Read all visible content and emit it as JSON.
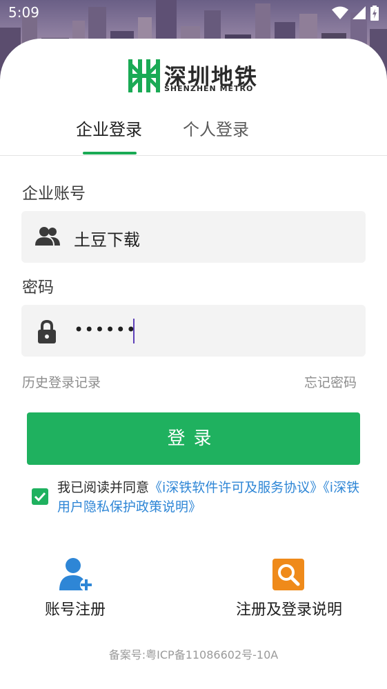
{
  "status_bar": {
    "time": "5:09",
    "icons": [
      "wifi-icon",
      "cellular-signal-icon",
      "battery-charging-icon"
    ]
  },
  "logo": {
    "name_cn": "深圳地铁",
    "name_en": "SHENZHEN METRO"
  },
  "tabs": [
    {
      "label": "企业登录",
      "active": true
    },
    {
      "label": "个人登录",
      "active": false
    }
  ],
  "form": {
    "account_label": "企业账号",
    "account_value": "土豆下载",
    "account_icon": "group-icon",
    "password_label": "密码",
    "password_value": "••••••",
    "password_icon": "lock-icon"
  },
  "links": {
    "history": "历史登录记录",
    "forgot": "忘记密码"
  },
  "login_button": "登录",
  "agreement": {
    "checked": true,
    "prefix": "我已阅读并同意",
    "link1": "《i深铁软件许可及服务协议》",
    "link2": "《i深铁用户隐私保护政策说明》"
  },
  "bottom_actions": [
    {
      "label": "账号注册",
      "icon": "user-add-icon",
      "color": "#2e86d6"
    },
    {
      "label": "注册及登录说明",
      "icon": "search-icon",
      "color": "#ef8a1a"
    }
  ],
  "footer": "备案号:粤ICP备11086602号-10A",
  "colors": {
    "accent": "#1fb15f",
    "link": "#2e86d6"
  }
}
